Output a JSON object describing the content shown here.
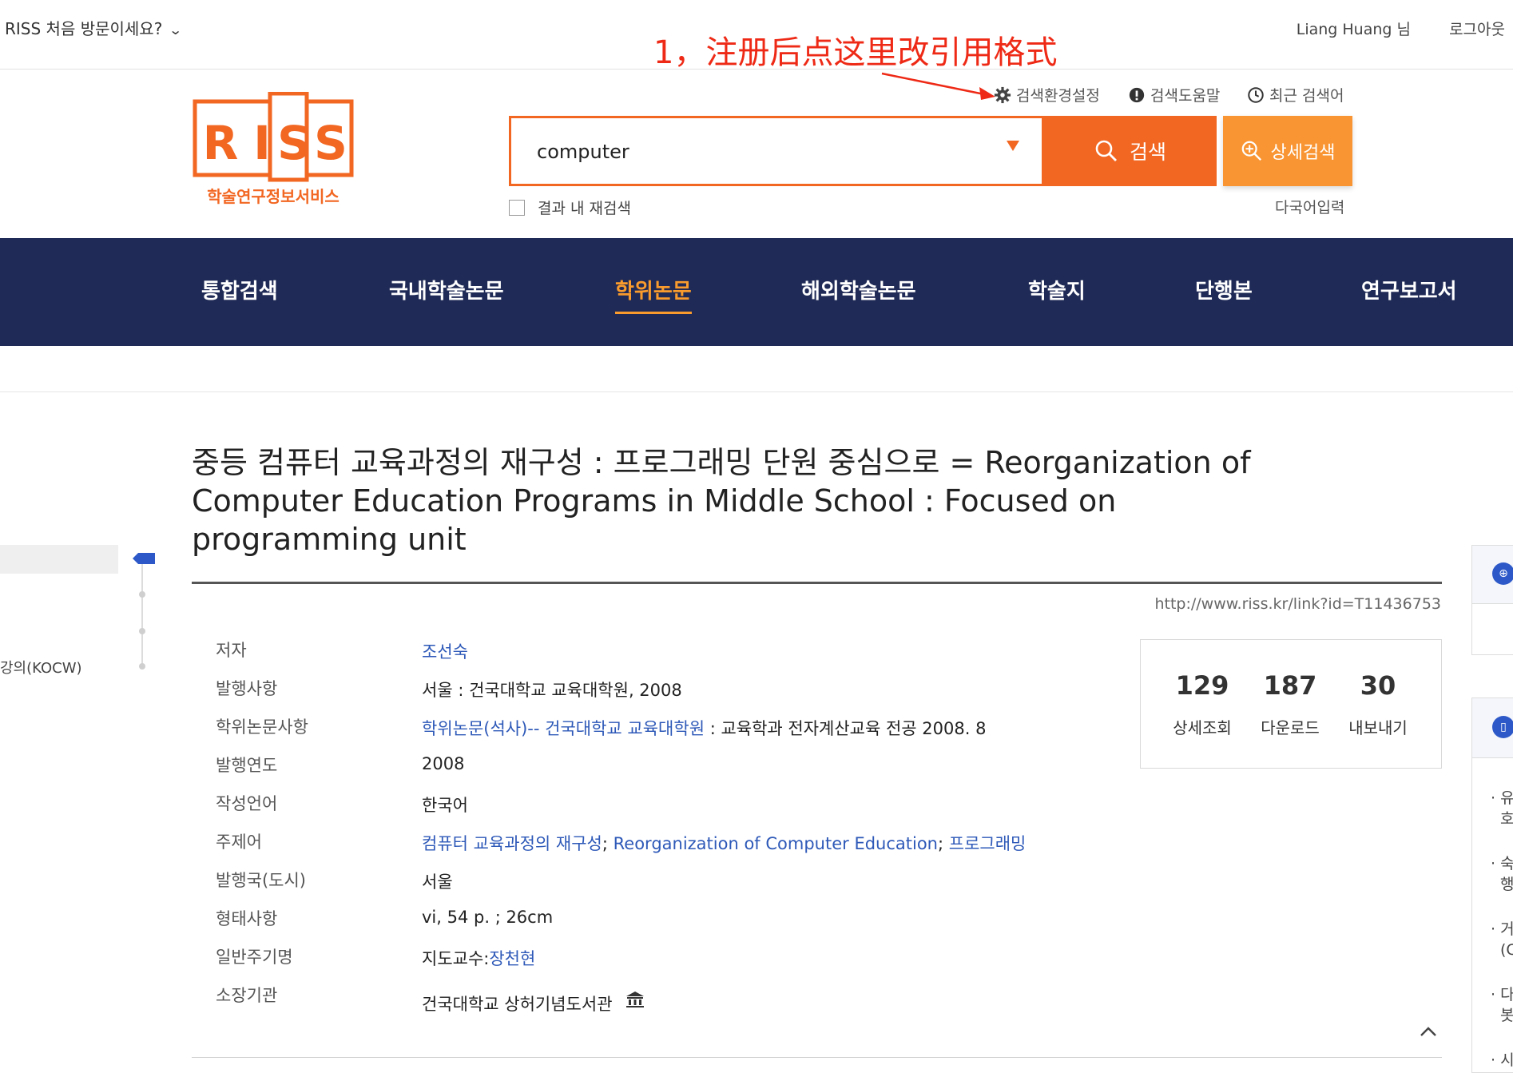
{
  "topbar": {
    "first_visit": "RISS 처음 방문이세요?",
    "user": "Liang Huang 님",
    "logout": "로그아웃"
  },
  "annotation": "1，注册后点这里改引用格式",
  "logo": {
    "letters": [
      "R",
      "I",
      "S",
      "S"
    ],
    "subtitle": "학술연구정보서비스",
    "color": "#f26722"
  },
  "search_tools": {
    "settings": "검색환경설정",
    "help": "검색도움말",
    "recent": "최근 검색어"
  },
  "search": {
    "query": "computer",
    "button": "검색",
    "advanced": "상세검색",
    "refine_label": "결과 내 재검색",
    "multilang": "다국어입력",
    "accent": "#f26722"
  },
  "nav": {
    "items": [
      "통합검색",
      "국내학술논문",
      "학위논문",
      "해외학술논문",
      "학술지",
      "단행본",
      "연구보고서"
    ],
    "active_index": 2,
    "background": "#1f2a56",
    "active_color": "#f99b2d"
  },
  "sidebar": {
    "kocw": "강의(KOCW)"
  },
  "record": {
    "title": "중등 컴퓨터 교육과정의 재구성 : 프로그래밍 단원 중심으로 = Reorganization of Computer Education Programs in Middle School : Focused on programming unit",
    "permalink": "http://www.riss.kr/link?id=T11436753",
    "labels": {
      "author": "저자",
      "publication": "발행사항",
      "degree": "학위논문사항",
      "year": "발행연도",
      "language": "작성언어",
      "keywords": "주제어",
      "country": "발행국(도시)",
      "format": "형태사항",
      "notes": "일반주기명",
      "holding": "소장기관"
    },
    "values": {
      "author": "조선숙",
      "publication": "서울 : 건국대학교 교육대학원, 2008",
      "degree_link": "학위논문(석사)-- 건국대학교 교육대학원",
      "degree_rest": " : 교육학과 전자계산교육 전공 2008. 8",
      "year": "2008",
      "language": "한국어",
      "keyword1": "컴퓨터 교육과정의 재구성",
      "keyword2": "Reorganization of Computer Education",
      "keyword3": "프로그래밍",
      "keyword_sep": ";",
      "country": "서울",
      "format": "vi, 54 p. ; 26cm",
      "notes_prefix": "지도교수:",
      "notes_link": "장천현",
      "holding": "건국대학교 상허기념도서관"
    }
  },
  "stats": [
    {
      "value": "129",
      "label": "상세조회"
    },
    {
      "value": "187",
      "label": "다운로드"
    },
    {
      "value": "30",
      "label": "내보내기"
    }
  ],
  "right_panel": {
    "bullets": [
      "· 유",
      "호",
      "· 숙",
      "행",
      "· 거",
      "(C",
      "· 다",
      "봇",
      "· 시"
    ]
  }
}
